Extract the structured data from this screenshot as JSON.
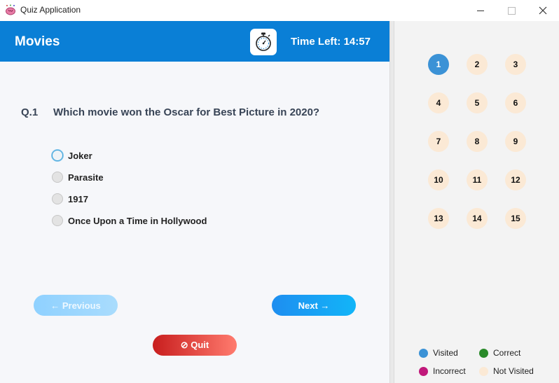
{
  "window": {
    "title": "Quiz Application"
  },
  "header": {
    "topic": "Movies",
    "timer_label": "Time Left: 14:57"
  },
  "question": {
    "number": "Q.1",
    "text": "Which movie won the Oscar for Best Picture in 2020?",
    "options": [
      "Joker",
      "Parasite",
      "1917",
      "Once Upon a Time in Hollywood"
    ]
  },
  "buttons": {
    "previous": "← Previous",
    "next": "Next →",
    "quit": "⊘ Quit"
  },
  "navigator": {
    "questions": [
      "1",
      "2",
      "3",
      "4",
      "5",
      "6",
      "7",
      "8",
      "9",
      "10",
      "11",
      "12",
      "13",
      "14",
      "15"
    ],
    "current": "1"
  },
  "legend": {
    "visited": "Visited",
    "correct": "Correct",
    "incorrect": "Incorrect",
    "not_visited": "Not Visited"
  },
  "colors": {
    "header": "#0a7fd6",
    "visited": "#3b92d6",
    "correct": "#2a8a2a",
    "incorrect": "#c0187a",
    "not_visited": "#fbe9d5"
  }
}
